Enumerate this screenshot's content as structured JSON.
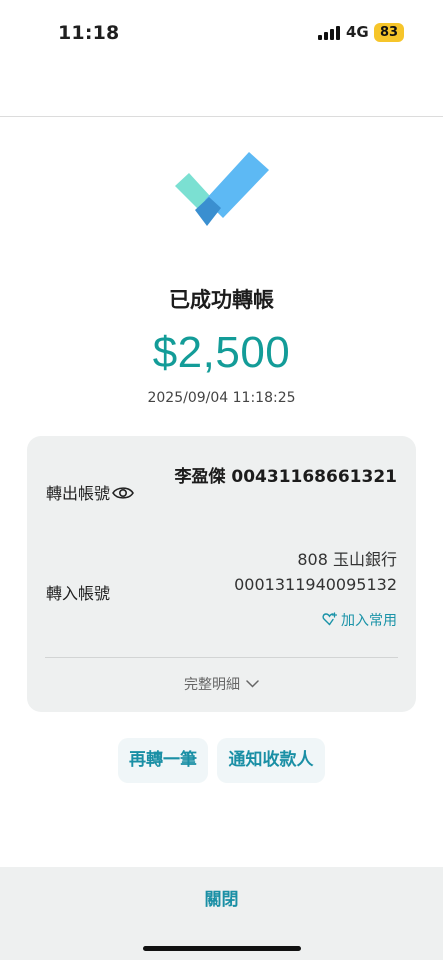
{
  "status_bar": {
    "time": "11:18",
    "network": "4G",
    "battery": "83",
    "battery_color": "#f6c52a"
  },
  "result": {
    "title": "已成功轉帳",
    "amount": "$2,500",
    "datetime": "2025/09/04 11:18:25",
    "accent_color": "#139c98"
  },
  "card": {
    "from_label": "轉出帳號",
    "from_value": "李盈傑 00431168661321",
    "to_label": "轉入帳號",
    "to_bank": "808 玉山銀行",
    "to_account": "0001311940095132",
    "add_favorite": "加入常用",
    "full_details": "完整明細"
  },
  "actions": {
    "transfer_again": "再轉一筆",
    "notify_payee": "通知收款人"
  },
  "footer": {
    "close": "關閉"
  },
  "icons": [
    "signal-icon",
    "check-icon",
    "eye-icon",
    "heart-plus-icon",
    "chevron-down-icon"
  ]
}
